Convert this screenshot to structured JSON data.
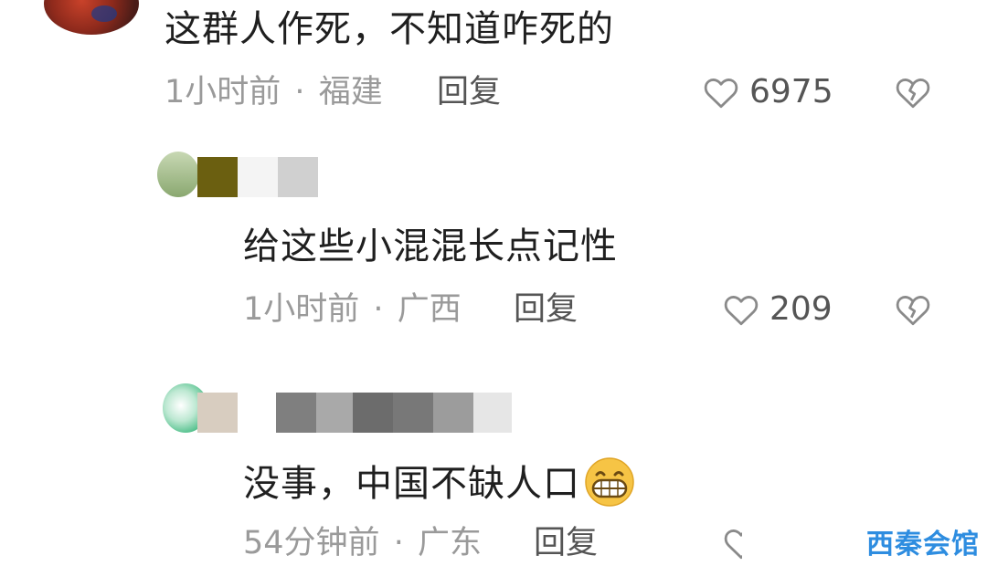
{
  "comments": [
    {
      "text": "这群人作死，不知道咋死的",
      "time": "1小时前",
      "sep": "·",
      "location": "福建",
      "reply_label": "回复",
      "like_count": "6975"
    },
    {
      "text": "给这些小混混长点记性",
      "time": "1小时前",
      "sep": "·",
      "location": "广西",
      "reply_label": "回复",
      "like_count": "209"
    },
    {
      "text": "没事，中国不缺人口",
      "time": "54分钟前",
      "sep": "·",
      "location": "广东",
      "reply_label": "回复"
    }
  ],
  "icons": {
    "like": "heart-outline-icon",
    "dislike": "broken-heart-icon",
    "emoji": "grinning-face-emoji-icon"
  },
  "watermark": "西秦会馆",
  "colors": {
    "meta_text": "#9a9a9a",
    "action_text": "#555555",
    "watermark": "#2e8de0",
    "emoji_face": "#f6c445"
  }
}
